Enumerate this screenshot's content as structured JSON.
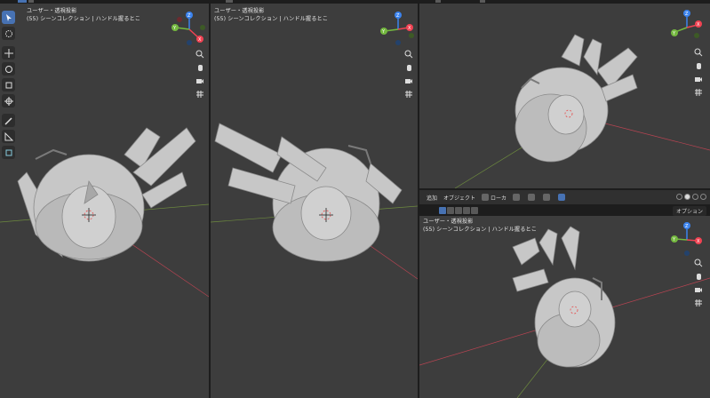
{
  "viewports": [
    {
      "id": "vp1",
      "line1": "ユーザー・透視投影",
      "line2": "(55) シーンコレクション | ハンドル握るとこ"
    },
    {
      "id": "vp2",
      "line1": "ユーザー・透視投影",
      "line2": "(55) シーンコレクション | ハンドル握るとこ"
    },
    {
      "id": "vp3",
      "line1": "",
      "line2": ""
    },
    {
      "id": "vp4",
      "line1": "ユーザー・透視投影",
      "line2": "(55) シーンコレクション | ハンドル握るとこ"
    }
  ],
  "header": {
    "add_menu": "追加",
    "object_menu": "オブジェクト",
    "transform_orientation": "ローカ",
    "options": "オプション"
  },
  "gizmo_labels": {
    "x": "X",
    "y": "Y",
    "z": "Z"
  },
  "colors": {
    "viewport_bg": "#3d3d3d",
    "x_axis": "#f14353",
    "y_axis": "#75b940",
    "z_axis": "#3b83ee",
    "active_tool": "#4772b3",
    "model": "#c9c9c9"
  },
  "tools": [
    "select-box-icon",
    "cursor-icon",
    "move-icon",
    "rotate-icon",
    "scale-icon",
    "transform-icon",
    "annotate-icon",
    "measure-icon",
    "add-cube-icon"
  ],
  "nav_icons": [
    "zoom-icon",
    "hand-icon",
    "camera-icon",
    "grid-icon"
  ]
}
